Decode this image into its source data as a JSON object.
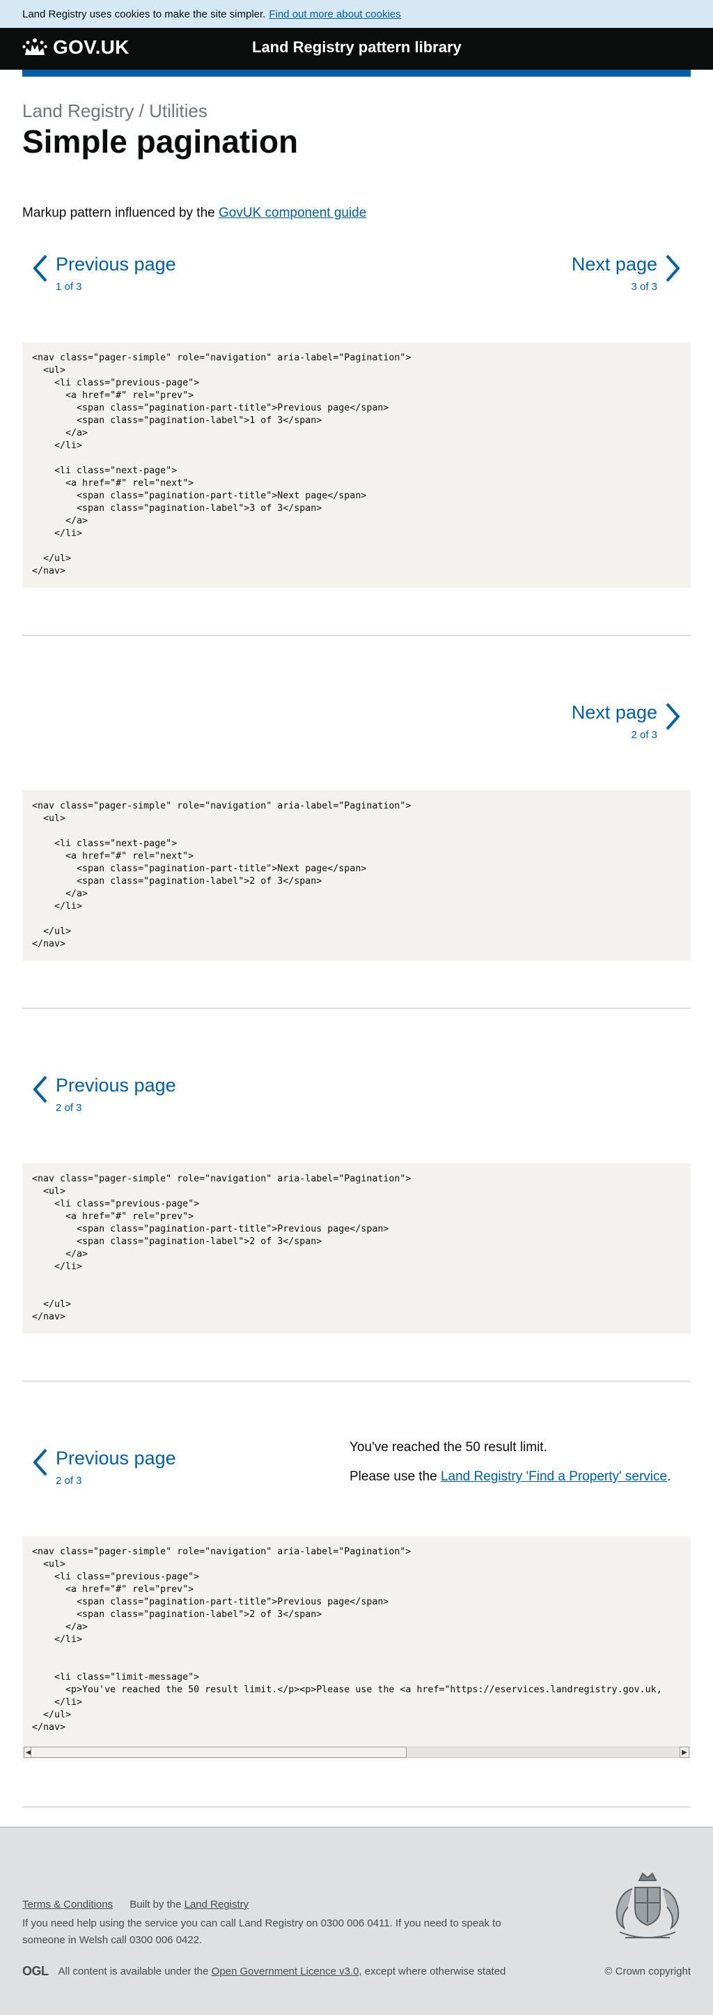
{
  "cookie_banner": {
    "text": "Land Registry uses cookies to make the site simpler.",
    "link": "Find out more about cookies"
  },
  "header": {
    "logo_text": "GOV.UK",
    "service_name": "Land Registry pattern library"
  },
  "breadcrumb": "Land Registry / Utilities",
  "page_title": "Simple pagination",
  "intro": {
    "text": "Markup pattern influenced by the",
    "link": "GovUK component guide"
  },
  "examples": [
    {
      "previous": {
        "title": "Previous page",
        "label": "1 of 3"
      },
      "next": {
        "title": "Next page",
        "label": "3 of 3"
      },
      "code": "<nav class=\"pager-simple\" role=\"navigation\" aria-label=\"Pagination\">\n  <ul>\n    <li class=\"previous-page\">\n      <a href=\"#\" rel=\"prev\">\n        <span class=\"pagination-part-title\">Previous page</span>\n        <span class=\"pagination-label\">1 of 3</span>\n      </a>\n    </li>\n\n    <li class=\"next-page\">\n      <a href=\"#\" rel=\"next\">\n        <span class=\"pagination-part-title\">Next page</span>\n        <span class=\"pagination-label\">3 of 3</span>\n      </a>\n    </li>\n\n  </ul>\n</nav>"
    },
    {
      "next": {
        "title": "Next page",
        "label": "2 of 3"
      },
      "code": "<nav class=\"pager-simple\" role=\"navigation\" aria-label=\"Pagination\">\n  <ul>\n\n    <li class=\"next-page\">\n      <a href=\"#\" rel=\"next\">\n        <span class=\"pagination-part-title\">Next page</span>\n        <span class=\"pagination-label\">2 of 3</span>\n      </a>\n    </li>\n\n  </ul>\n</nav>"
    },
    {
      "previous": {
        "title": "Previous page",
        "label": "2 of 3"
      },
      "code": "<nav class=\"pager-simple\" role=\"navigation\" aria-label=\"Pagination\">\n  <ul>\n    <li class=\"previous-page\">\n      <a href=\"#\" rel=\"prev\">\n        <span class=\"pagination-part-title\">Previous page</span>\n        <span class=\"pagination-label\">2 of 3</span>\n      </a>\n    </li>\n\n\n  </ul>\n</nav>"
    },
    {
      "previous": {
        "title": "Previous page",
        "label": "2 of 3"
      },
      "limit_message": {
        "line1": "You've reached the 50 result limit.",
        "line2_prefix": "Please use the",
        "line2_link": "Land Registry 'Find a Property' service",
        "line2_suffix": "."
      },
      "code": "<nav class=\"pager-simple\" role=\"navigation\" aria-label=\"Pagination\">\n  <ul>\n    <li class=\"previous-page\">\n      <a href=\"#\" rel=\"prev\">\n        <span class=\"pagination-part-title\">Previous page</span>\n        <span class=\"pagination-label\">2 of 3</span>\n      </a>\n    </li>\n\n\n    <li class=\"limit-message\">\n      <p>You've reached the 50 result limit.</p><p>Please use the <a href=\"https://eservices.landregistry.gov.uk,\n    </li>\n  </ul>\n</nav>"
    }
  ],
  "footer": {
    "terms_link": "Terms & Conditions",
    "built_by_text": "Built by the",
    "built_by_link": "Land Registry",
    "help_text": "If you need help using the service you can call Land Registry on 0300 006 0411. If you need to speak to someone in Welsh call 0300 006 0422.",
    "ogl_logo": "OGL",
    "licence_prefix": "All content is available under the",
    "licence_link": "Open Government Licence v3.0",
    "licence_suffix": ", except where otherwise stated",
    "copyright": "© Crown copyright"
  },
  "icons": {
    "crown": "crown-icon",
    "chevron_left": "chevron-left-icon",
    "chevron_right": "chevron-right-icon",
    "royal_arms": "royal-coat-of-arms-icon"
  },
  "colors": {
    "link": "#005ea5",
    "header_bg": "#0b0c0c",
    "header_bar": "#005ea5",
    "cookie_bg": "#d5e8f3",
    "code_bg": "#f4f2ef",
    "footer_bg": "#dee0e2"
  }
}
